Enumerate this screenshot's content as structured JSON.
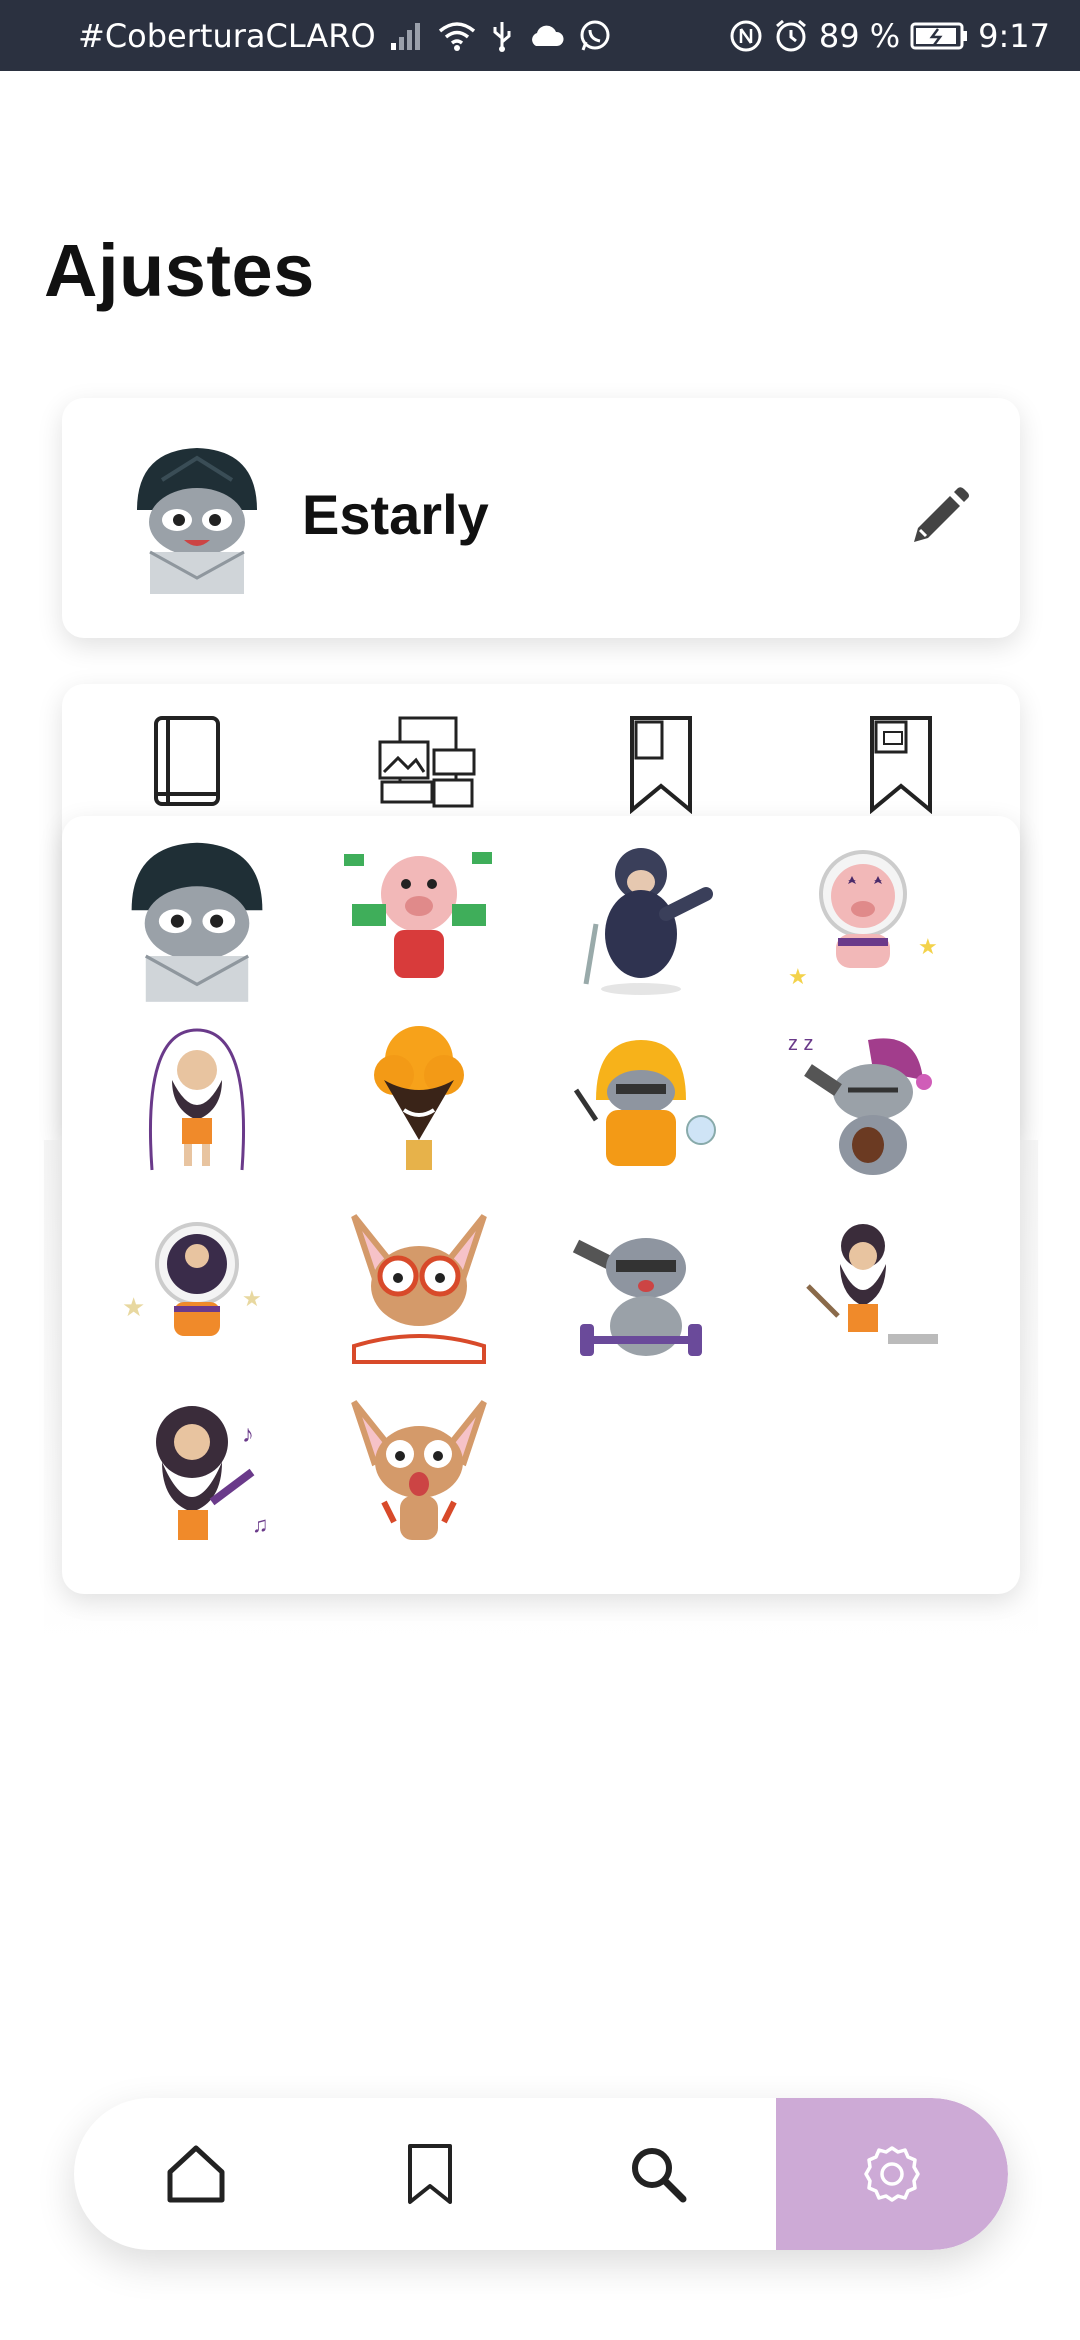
{
  "status_bar": {
    "carrier": "#CoberturaCLARO",
    "battery": "89 %",
    "time": "9:17",
    "icons": [
      "signal-icon",
      "wifi-icon",
      "usb-icon",
      "cloud-icon",
      "whatsapp-icon",
      "nfc-icon",
      "alarm-icon",
      "battery-icon"
    ]
  },
  "page": {
    "title": "Ajustes"
  },
  "profile": {
    "name": "Estarly",
    "edit_icon": "pencil-icon"
  },
  "library": {
    "icons": [
      "book-icon",
      "media-files-icon",
      "bookmark-book-icon",
      "bookmark-media-icon"
    ]
  },
  "avatar_picker": {
    "options": [
      "raccoon-hooded",
      "pig-money",
      "gorilla-crutch",
      "pig-astronaut",
      "caveman-jumprope",
      "wolf-explosion",
      "raccoon-hazmat",
      "raccoon-sleepy",
      "caveman-astronaut",
      "chihuahua-reading",
      "raccoon-weights",
      "caveman-tools",
      "caveman-music",
      "chihuahua-scared"
    ]
  },
  "bottom_nav": {
    "items": [
      "home-icon",
      "bookmark-icon",
      "search-icon",
      "settings-icon"
    ],
    "active": "settings-icon",
    "active_color": "#cdaad6"
  },
  "colors": {
    "status_bar": "#2b3140",
    "background": "#ffffff",
    "icon": "#222222"
  }
}
